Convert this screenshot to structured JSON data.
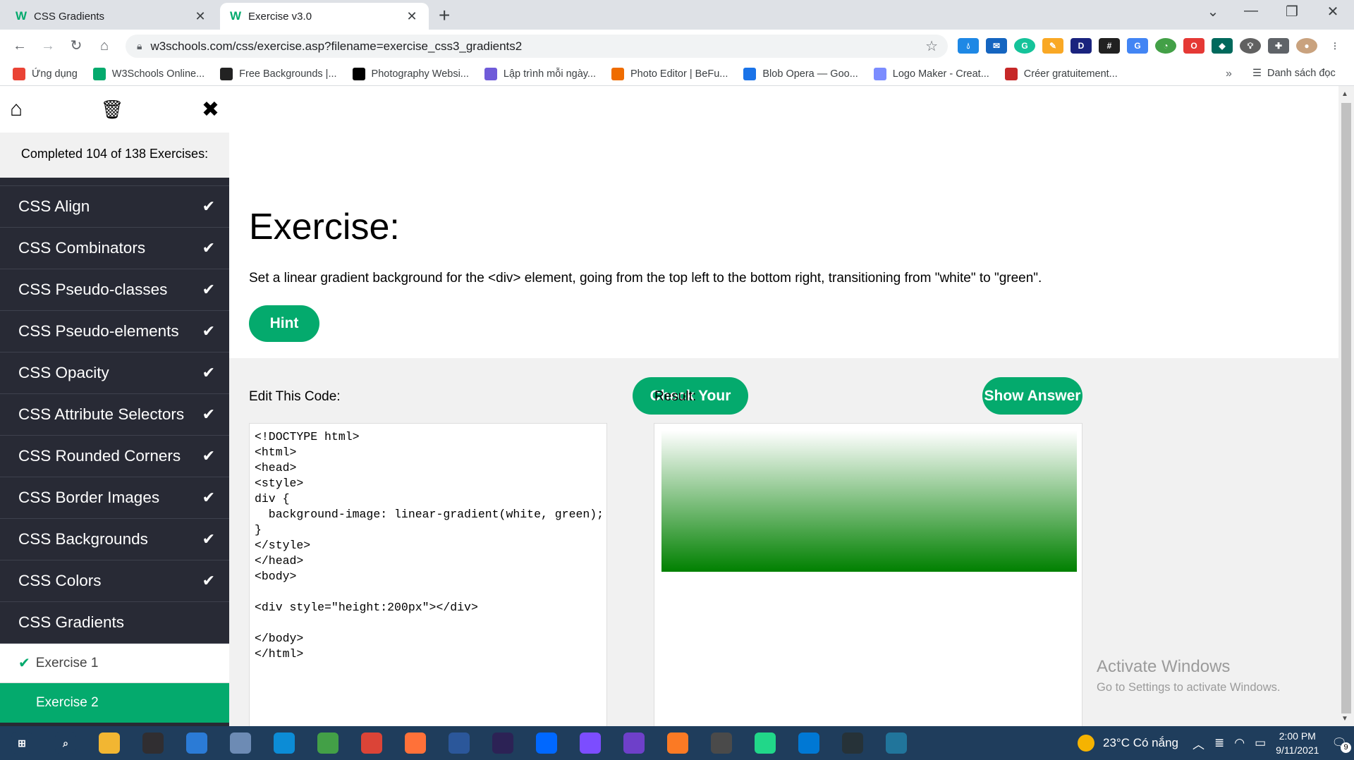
{
  "browser": {
    "tabs": [
      {
        "title": "CSS Gradients",
        "favicon": "W"
      },
      {
        "title": "Exercise v3.0",
        "favicon": "W"
      }
    ],
    "url": "w3schools.com/css/exercise.asp?filename=exercise_css3_gradients2",
    "bookmarks": [
      {
        "label": "Ứng dụng",
        "icon": "apps-grid-icon",
        "color": "#ea4335"
      },
      {
        "label": "W3Schools Online...",
        "icon": "w3schools-icon",
        "color": "#04aa6d"
      },
      {
        "label": "Free Backgrounds |...",
        "icon": "backgrounds-icon",
        "color": "#222222"
      },
      {
        "label": "Photography Websi...",
        "icon": "wix-icon",
        "color": "#000000"
      },
      {
        "label": "Lập trình mỗi ngày...",
        "icon": "code-icon",
        "color": "#6f5bd9"
      },
      {
        "label": "Photo Editor | BeFu...",
        "icon": "befunky-icon",
        "color": "#ef6c00"
      },
      {
        "label": "Blob Opera — Goo...",
        "icon": "arts-culture-icon",
        "color": "#1a73e8"
      },
      {
        "label": "Logo Maker - Creat...",
        "icon": "logo-maker-icon",
        "color": "#7b8cff"
      },
      {
        "label": "Créer gratuitement...",
        "icon": "sp-icon",
        "color": "#c62828"
      }
    ],
    "more_label": "»",
    "reading_list_label": "Danh sách đọc"
  },
  "sidebar": {
    "progress": "Completed 104 of 138 Exercises:",
    "items": [
      {
        "label": "CSS Align",
        "done": true
      },
      {
        "label": "CSS Combinators",
        "done": true
      },
      {
        "label": "CSS Pseudo-classes",
        "done": true
      },
      {
        "label": "CSS Pseudo-elements",
        "done": true
      },
      {
        "label": "CSS Opacity",
        "done": true
      },
      {
        "label": "CSS Attribute Selectors",
        "done": true
      },
      {
        "label": "CSS Rounded Corners",
        "done": true
      },
      {
        "label": "CSS Border Images",
        "done": true
      },
      {
        "label": "CSS Backgrounds",
        "done": true
      },
      {
        "label": "CSS Colors",
        "done": true
      },
      {
        "label": "CSS Gradients",
        "done": false
      }
    ],
    "sub_items": [
      {
        "label": "Exercise 1",
        "done": true
      },
      {
        "label": "Exercise 2",
        "current": true
      }
    ]
  },
  "exercise": {
    "title": "Exercise:",
    "description": "Set a linear gradient background for the <div> element, going from the top left to the bottom right, transitioning from \"white\" to \"green\".",
    "hint_label": "Hint",
    "edit_label": "Edit This Code:",
    "check_label": "Check Your Code",
    "result_label": "Result:",
    "answer_label": "Show Answer",
    "code": "<!DOCTYPE html>\n<html>\n<head>\n<style>\ndiv {\n  background-image: linear-gradient(white, green);\n}\n</style>\n</head>\n<body>\n\n<div style=\"height:200px\"></div>\n\n</body>\n</html>",
    "result_gradient": [
      "#ffffff",
      "#008000"
    ]
  },
  "watermark": {
    "line1": "Activate Windows",
    "line2": "Go to Settings to activate Windows."
  },
  "taskbar": {
    "apps": [
      {
        "icon": "windows-start-icon",
        "color": "#1f3d5c"
      },
      {
        "icon": "search-icon",
        "color": "#1f3d5c"
      },
      {
        "icon": "file-explorer-icon",
        "color": "#f2b632"
      },
      {
        "icon": "obs-icon",
        "color": "#302e31"
      },
      {
        "icon": "teams-icon",
        "color": "#2b7bd6"
      },
      {
        "icon": "paint-icon",
        "color": "#6d8bb4"
      },
      {
        "icon": "edge-icon",
        "color": "#0c8cd6"
      },
      {
        "icon": "ccleaner-icon",
        "color": "#43a047"
      },
      {
        "icon": "chrome-icon",
        "color": "#db4437"
      },
      {
        "icon": "firefox-icon",
        "color": "#ff7139"
      },
      {
        "icon": "word-icon",
        "color": "#2b579a"
      },
      {
        "icon": "eclipse-icon",
        "color": "#2c2255"
      },
      {
        "icon": "zalo-icon",
        "color": "#0068ff"
      },
      {
        "icon": "bluestacks-icon",
        "color": "#7c4dff"
      },
      {
        "icon": "github-icon",
        "color": "#6e40c9"
      },
      {
        "icon": "xampp-icon",
        "color": "#fb7a24"
      },
      {
        "icon": "sublime-icon",
        "color": "#4a4a4a"
      },
      {
        "icon": "pycharm-icon",
        "color": "#21d789"
      },
      {
        "icon": "vscode-icon",
        "color": "#0078d4"
      },
      {
        "icon": "cursor-app-icon",
        "color": "#263238"
      },
      {
        "icon": "wordpress-icon",
        "color": "#21759b"
      }
    ],
    "weather": "23°C  Có nắng",
    "time": "2:00 PM",
    "date": "9/11/2021",
    "notification_count": "9"
  }
}
